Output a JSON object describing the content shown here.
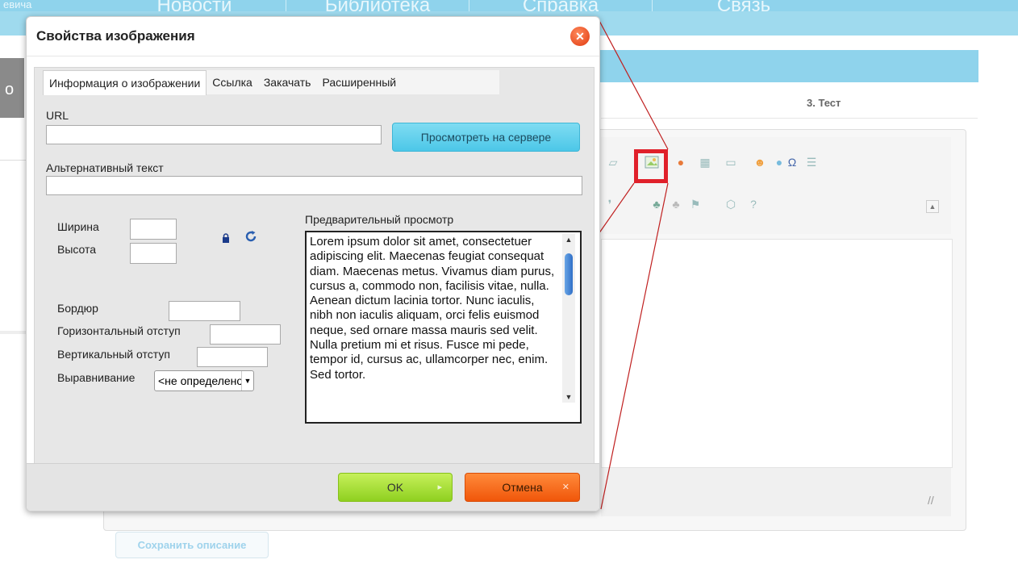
{
  "background": {
    "nav_left_label": "евича",
    "nav_items": [
      "Новости",
      "Библиотека",
      "Справка",
      "Связь"
    ],
    "left_letter": "о",
    "step_label": "3. Тест",
    "save_description": "Сохранить описание"
  },
  "dialog": {
    "title": "Свойства изображения",
    "close_symbol": "✕",
    "tabs": [
      {
        "label": "Информация о изображении",
        "active": true
      },
      {
        "label": "Ссылка",
        "active": false
      },
      {
        "label": "Закачать",
        "active": false
      },
      {
        "label": "Расширенный",
        "active": false
      }
    ],
    "url_label": "URL",
    "url_value": "",
    "browse_button": "Просмотреть на сервере",
    "alt_label": "Альтернативный текст",
    "alt_value": "",
    "width_label": "Ширина",
    "height_label": "Высота",
    "border_label": "Бордюр",
    "hspace_label": "Горизонтальный отступ",
    "vspace_label": "Вертикальный отступ",
    "align_label": "Выравнивание",
    "align_value": "<не определено>",
    "preview_label": "Предварительный просмотр",
    "preview_text": "Lorem ipsum dolor sit amet, consectetuer adipiscing elit. Maecenas feugiat consequat diam. Maecenas metus. Vivamus diam purus, cursus a, commodo non, facilisis vitae, nulla. Aenean dictum lacinia tortor. Nunc iaculis, nibh non iaculis aliquam, orci felis euismod neque, sed ornare massa mauris sed velit. Nulla pretium mi et risus. Fusce mi pede, tempor id, cursus ac, ullamcorper nec, enim. Sed tortor.",
    "ok_button": "OK",
    "cancel_button": "Отмена"
  },
  "colors": {
    "accent_blue": "#8fd3ec",
    "ok_green": "#8fd020",
    "cancel_orange": "#f0560a",
    "highlight_red": "#e0202a"
  }
}
